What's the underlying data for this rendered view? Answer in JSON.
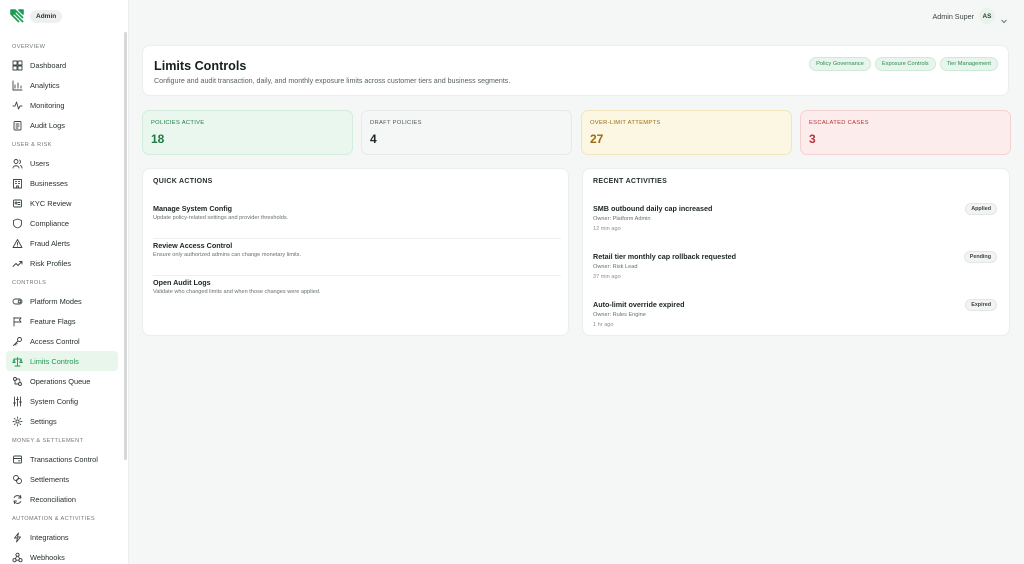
{
  "brand": {
    "label": "Admin",
    "logo_icon": "logo-icon"
  },
  "user": {
    "name": "Admin Super",
    "initials": "AS"
  },
  "sidebar": {
    "sections": [
      {
        "title": "OVERVIEW",
        "items": [
          {
            "label": "Dashboard",
            "icon": "dashboard-icon"
          },
          {
            "label": "Analytics",
            "icon": "analytics-icon"
          },
          {
            "label": "Monitoring",
            "icon": "monitoring-icon"
          },
          {
            "label": "Audit Logs",
            "icon": "audit-logs-icon"
          }
        ]
      },
      {
        "title": "USER & RISK",
        "items": [
          {
            "label": "Users",
            "icon": "users-icon"
          },
          {
            "label": "Businesses",
            "icon": "businesses-icon"
          },
          {
            "label": "KYC Review",
            "icon": "kyc-review-icon"
          },
          {
            "label": "Compliance",
            "icon": "compliance-icon"
          },
          {
            "label": "Fraud Alerts",
            "icon": "fraud-alerts-icon"
          },
          {
            "label": "Risk Profiles",
            "icon": "risk-profiles-icon"
          }
        ]
      },
      {
        "title": "CONTROLS",
        "items": [
          {
            "label": "Platform Modes",
            "icon": "platform-modes-icon"
          },
          {
            "label": "Feature Flags",
            "icon": "feature-flags-icon"
          },
          {
            "label": "Access Control",
            "icon": "access-control-icon"
          },
          {
            "label": "Limits Controls",
            "icon": "limits-controls-icon",
            "active": true
          },
          {
            "label": "Operations Queue",
            "icon": "operations-queue-icon"
          },
          {
            "label": "System Config",
            "icon": "system-config-icon"
          },
          {
            "label": "Settings",
            "icon": "settings-icon"
          }
        ]
      },
      {
        "title": "MONEY & SETTLEMENT",
        "items": [
          {
            "label": "Transactions Control",
            "icon": "transactions-control-icon"
          },
          {
            "label": "Settlements",
            "icon": "settlements-icon"
          },
          {
            "label": "Reconciliation",
            "icon": "reconciliation-icon"
          }
        ]
      },
      {
        "title": "AUTOMATION & ACTIVITIES",
        "items": [
          {
            "label": "Integrations",
            "icon": "integrations-icon"
          },
          {
            "label": "Webhooks",
            "icon": "webhooks-icon"
          }
        ]
      }
    ]
  },
  "header": {
    "title": "Limits Controls",
    "subtitle": "Configure and audit transaction, daily, and monthly exposure limits across customer tiers and business segments.",
    "tags": [
      "Policy Governance",
      "Exposure Controls",
      "Tier Management"
    ]
  },
  "stats": [
    {
      "label": "POLICIES ACTIVE",
      "value": "18"
    },
    {
      "label": "DRAFT POLICIES",
      "value": "4"
    },
    {
      "label": "OVER-LIMIT ATTEMPTS",
      "value": "27"
    },
    {
      "label": "ESCALATED CASES",
      "value": "3"
    }
  ],
  "quick_actions": {
    "title": "QUICK ACTIONS",
    "items": [
      {
        "title": "Manage System Config",
        "desc": "Update policy-related settings and provider thresholds."
      },
      {
        "title": "Review Access Control",
        "desc": "Ensure only authorized admins can change monetary limits."
      },
      {
        "title": "Open Audit Logs",
        "desc": "Validate who changed limits and when those changes were applied."
      }
    ]
  },
  "recent_activities": {
    "title": "RECENT ACTIVITIES",
    "items": [
      {
        "title": "SMB outbound daily cap increased",
        "owner": "Owner: Platform Admin",
        "time": "12 min ago",
        "status": "Applied"
      },
      {
        "title": "Retail tier monthly cap rollback requested",
        "owner": "Owner: Risk Lead",
        "time": "37 min ago",
        "status": "Pending"
      },
      {
        "title": "Auto-limit override expired",
        "owner": "Owner: Rules Engine",
        "time": "1 hr ago",
        "status": "Expired"
      }
    ]
  },
  "colors": {
    "accent": "#1f9a53",
    "active_bg": "#e8f6ec"
  }
}
